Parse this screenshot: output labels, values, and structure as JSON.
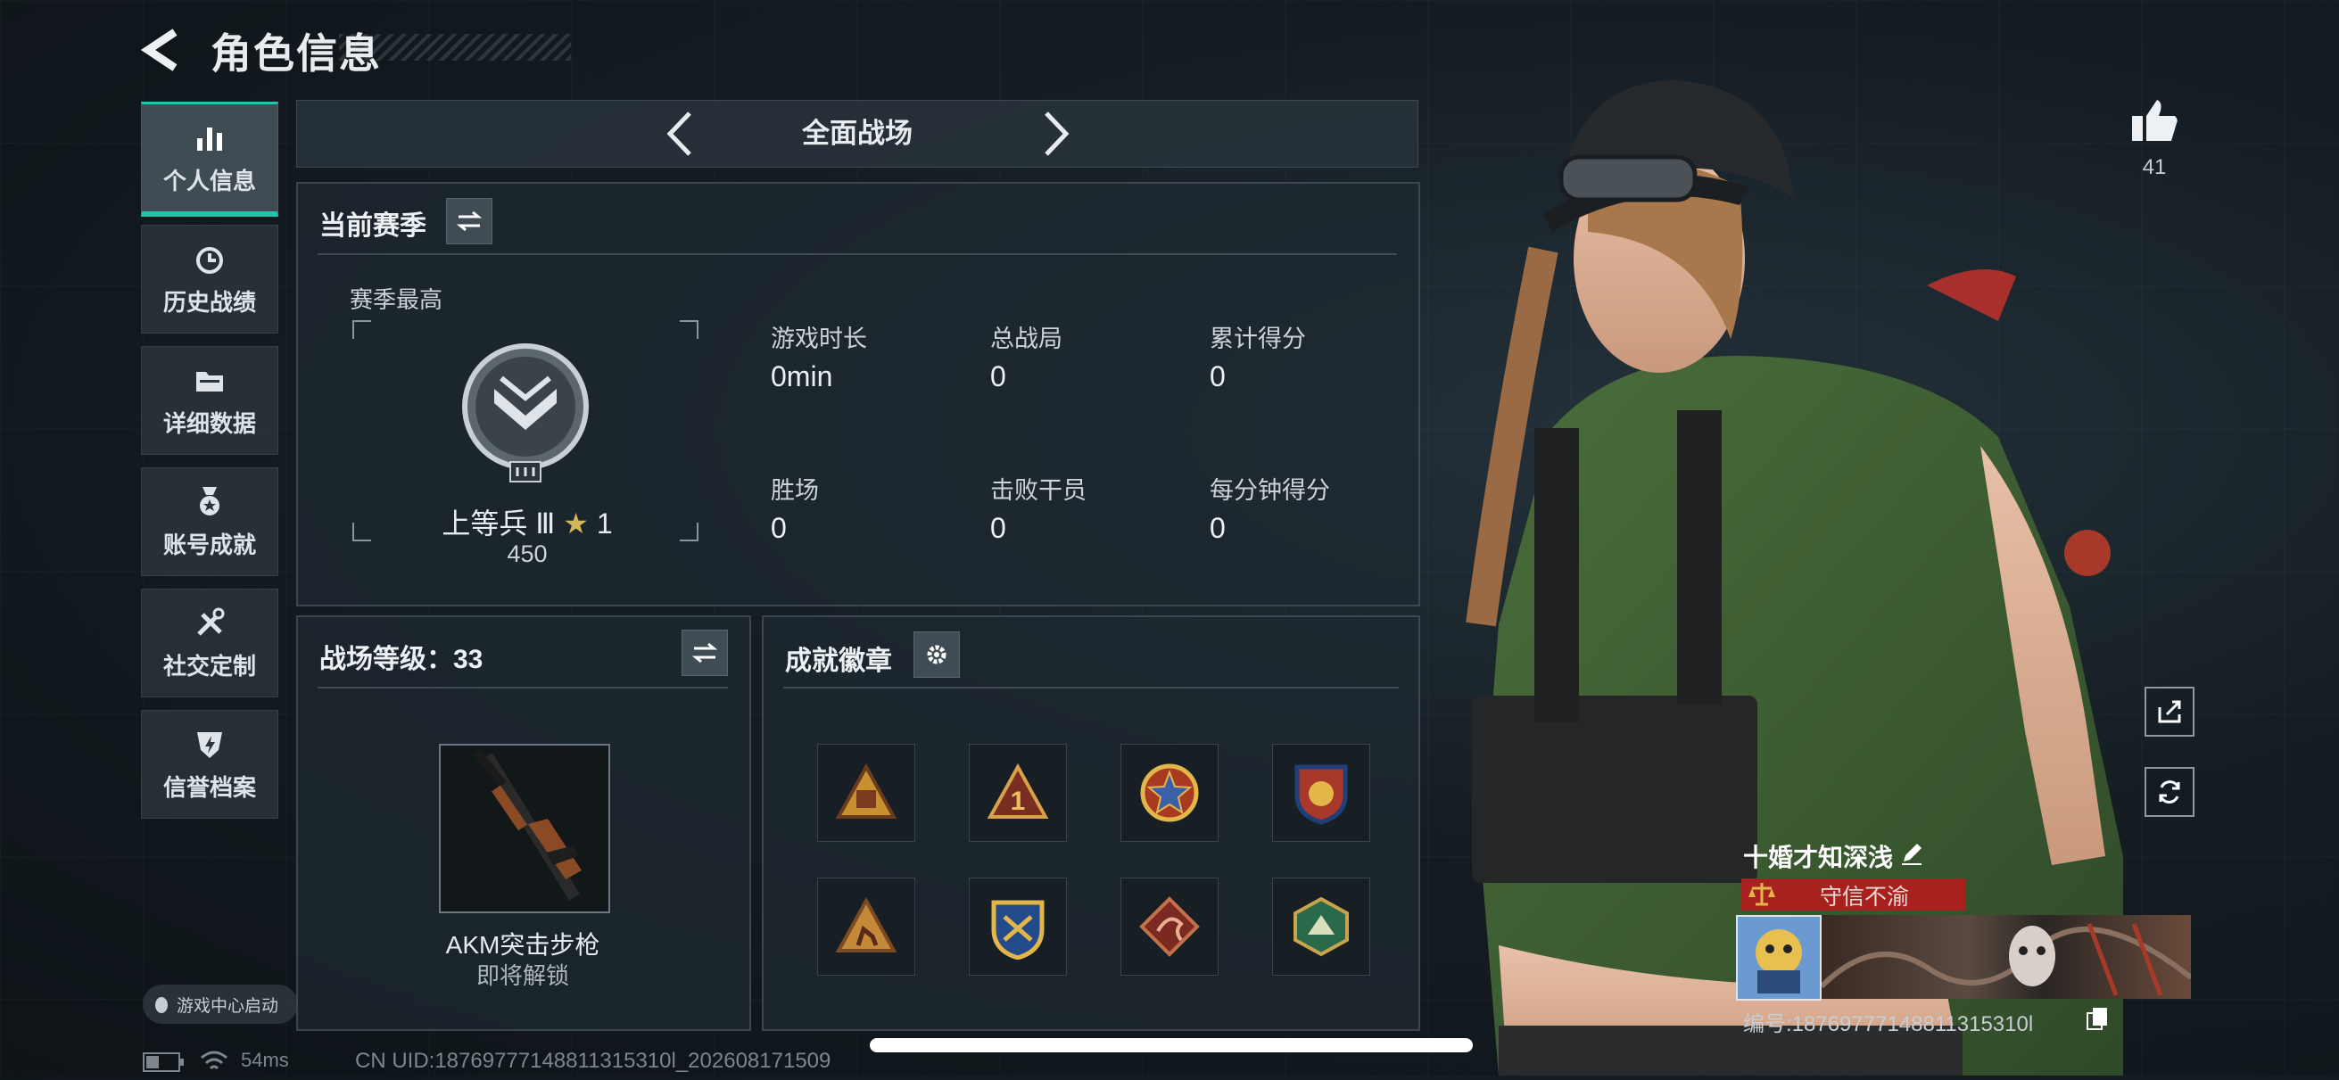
{
  "header": {
    "title": "角色信息"
  },
  "sidebar": {
    "items": [
      {
        "label": "个人信息",
        "icon": "bar-chart-icon",
        "active": true
      },
      {
        "label": "历史战绩",
        "icon": "history-clock-icon"
      },
      {
        "label": "详细数据",
        "icon": "folder-icon"
      },
      {
        "label": "账号成就",
        "icon": "medal-icon"
      },
      {
        "label": "社交定制",
        "icon": "tools-icon"
      },
      {
        "label": "信誉档案",
        "icon": "shield-bolt-icon"
      }
    ],
    "launch_label": "游戏中心启动"
  },
  "mode": {
    "label": "全面战场"
  },
  "season": {
    "title": "当前赛季",
    "best_label": "赛季最高",
    "rank_name": "上等兵 Ⅲ",
    "rank_stars": "1",
    "rank_points": "450",
    "stats": [
      {
        "label": "游戏时长",
        "value": "0min"
      },
      {
        "label": "总战局",
        "value": "0"
      },
      {
        "label": "累计得分",
        "value": "0"
      },
      {
        "label": "胜场",
        "value": "0"
      },
      {
        "label": "击败干员",
        "value": "0"
      },
      {
        "label": "每分钟得分",
        "value": "0"
      }
    ]
  },
  "level": {
    "title": "战场等级：33",
    "weapon_name": "AKM突击步枪",
    "weapon_status": "即将解锁"
  },
  "achievements": {
    "title": "成就徽章",
    "badges": [
      "triangle-gold-badge",
      "triangle-one-badge",
      "star-wreath-badge",
      "shield-blue-badge",
      "triangle-runner-badge",
      "crest-blue-badge",
      "dragon-red-badge",
      "hex-green-badge"
    ]
  },
  "profile": {
    "likes": "41",
    "player_name": "十婚才知深浅",
    "honor": "守信不渝",
    "uid_line": "编号:18769777148811315310l"
  },
  "status_bar": {
    "ping": "54ms",
    "uid_line": "CN UID:18769777148811315310l_202608171509"
  },
  "colors": {
    "accent": "#23c4a9",
    "honor_red": "#a7221f"
  }
}
